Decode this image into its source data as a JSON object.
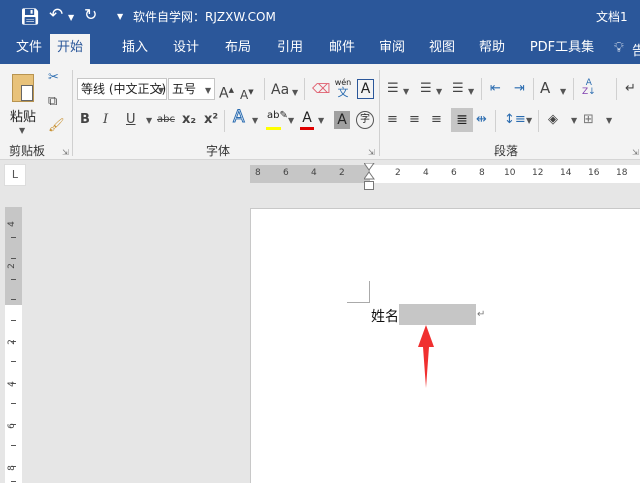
{
  "titlebar": {
    "title": "软件自学网：RJZXW.COM",
    "doc_name": "文档1"
  },
  "tabs": [
    "文件",
    "开始",
    "插入",
    "设计",
    "布局",
    "引用",
    "邮件",
    "审阅",
    "视图",
    "帮助",
    "PDF工具集"
  ],
  "tell_me": "告",
  "ribbon": {
    "clipboard": {
      "paste_label": "粘贴",
      "group_label": "剪贴板"
    },
    "font": {
      "font_name": "等线 (中文正文)",
      "font_size": "五号",
      "change_case": "Aa",
      "phonetic_top": "wén",
      "phonetic_bottom": "文",
      "bold": "B",
      "italic": "I",
      "underline": "U",
      "strike": "abc",
      "sub": "x₂",
      "sup": "x²",
      "enclose": "字",
      "group_label": "字体"
    },
    "paragraph": {
      "group_label": "段落"
    },
    "colors": {
      "highlight": "#ffff00",
      "font_color": "#e00000",
      "accent": "#2b579a"
    }
  },
  "ruler": {
    "horizontal_ticks": [
      "8",
      "6",
      "4",
      "2",
      "2",
      "4",
      "6",
      "8",
      "10",
      "12",
      "14",
      "16",
      "18"
    ],
    "vertical_ticks": [
      "4",
      "2",
      "2",
      "4",
      "6",
      "8"
    ],
    "corner": "L"
  },
  "document": {
    "text": "姓名:",
    "paragraph_mark": "↵"
  }
}
